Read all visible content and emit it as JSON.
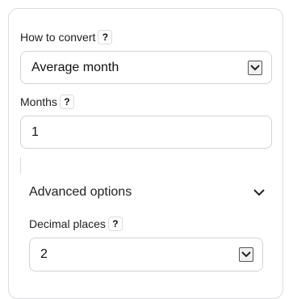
{
  "how_to_convert": {
    "label": "How to convert",
    "help": "?",
    "selected": "Average month"
  },
  "months": {
    "label": "Months",
    "help": "?",
    "value": "1"
  },
  "advanced": {
    "title": "Advanced options",
    "decimal_places": {
      "label": "Decimal places",
      "help": "?",
      "selected": "2"
    }
  },
  "icons": {
    "help": "question-mark",
    "select": "chevron-down",
    "expand": "chevron-down"
  }
}
